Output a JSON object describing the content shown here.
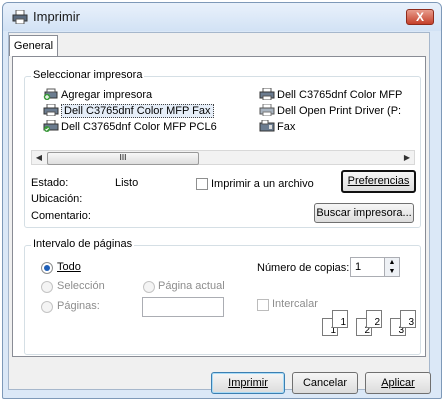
{
  "window": {
    "title": "Imprimir",
    "close_label": "X"
  },
  "tabs": [
    {
      "label": "General",
      "active": true
    }
  ],
  "select_printer": {
    "group_label": "Seleccionar impresora",
    "printers": [
      {
        "label": "Agregar impresora",
        "icon": "add-printer-icon"
      },
      {
        "label": "Dell C3765dnf Color MFP Fax",
        "icon": "printer-icon",
        "selected": true
      },
      {
        "label": "Dell C3765dnf Color MFP PCL6",
        "icon": "default-printer-icon"
      },
      {
        "label": "Dell C3765dnf Color MFP",
        "icon": "printer-icon"
      },
      {
        "label": "Dell Open Print Driver (P:",
        "icon": "printer-icon"
      },
      {
        "label": "Fax",
        "icon": "fax-icon"
      }
    ],
    "scroll_thumb_label": "III",
    "status_label": "Estado:",
    "status_value": "Listo",
    "location_label": "Ubicación:",
    "comment_label": "Comentario:",
    "print_to_file_label": "Imprimir a un archivo",
    "print_to_file_checked": false,
    "preferences_button": "Preferencias",
    "find_printer_button": "Buscar impresora..."
  },
  "page_range": {
    "group_label": "Intervalo de páginas",
    "all_label": "Todo",
    "selection_label": "Selección",
    "current_page_label": "Página actual",
    "pages_label": "Páginas:",
    "selected_option": "all"
  },
  "copies": {
    "label": "Número de copias:",
    "value": "1",
    "collate_label": "Intercalar",
    "collate_checked": false,
    "collate_pages": [
      "1",
      "1",
      "2",
      "2",
      "3",
      "3"
    ]
  },
  "footer": {
    "print_button": "Imprimir",
    "cancel_button": "Cancelar",
    "apply_button": "Aplicar"
  },
  "colors": {
    "accent": "#1f5fb8",
    "window_frame": "#dbe8f7",
    "close_button": "#c5402a"
  }
}
